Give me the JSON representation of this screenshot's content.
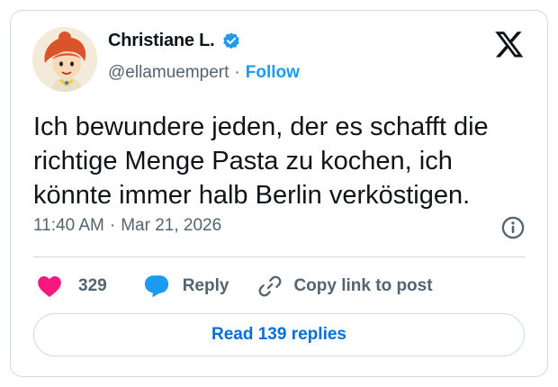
{
  "author": {
    "display_name": "Christiane L.",
    "handle": "@ellamuempert",
    "separator": "·",
    "follow_label": "Follow",
    "verified": true
  },
  "tweet": {
    "text": "Ich bewundere jeden, der es schafft die richtige Menge Pasta zu kochen, ich könnte immer halb Berlin verköstigen.",
    "time": "11:40 AM",
    "separator": "·",
    "date": "Mar 21, 2026"
  },
  "actions": {
    "like_count": "329",
    "reply_label": "Reply",
    "copy_label": "Copy link to post"
  },
  "footer": {
    "read_replies_label": "Read 139 replies"
  },
  "icons": {
    "avatar": "cartoon-avatar",
    "verified": "verified-badge-icon",
    "brand": "x-logo-icon",
    "info": "info-icon",
    "like": "heart-icon",
    "reply": "speech-bubble-icon",
    "copy": "link-icon"
  },
  "colors": {
    "accent": "#1d9bf0",
    "like": "#f91880",
    "text_primary": "#0f1419",
    "text_secondary": "#536471",
    "border": "#cfd9de"
  }
}
